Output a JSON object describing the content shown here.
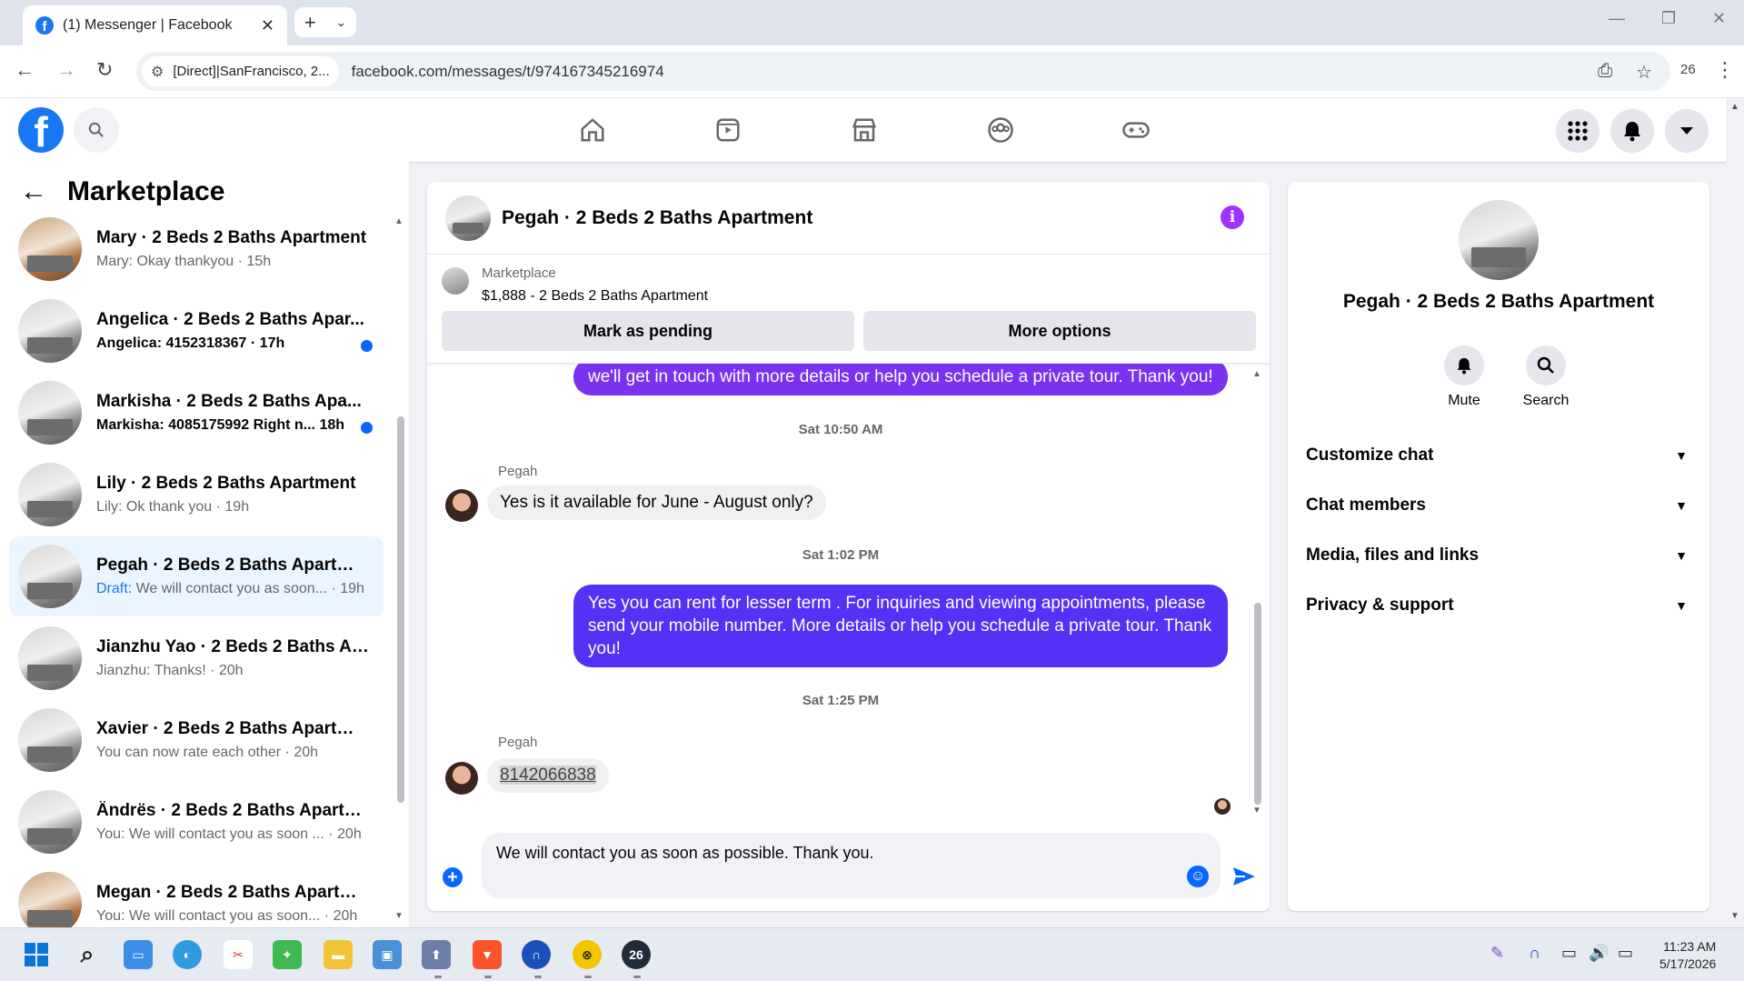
{
  "browser": {
    "tab_title": "(1) Messenger | Facebook",
    "site_chip": "[Direct]|SanFrancisco, 2...",
    "url": "facebook.com/messages/t/974167345216974",
    "extension_badge": "26"
  },
  "left": {
    "title": "Marketplace",
    "conversations": [
      {
        "name": "Mary · 2 Beds 2 Baths Apartment",
        "preview": "Mary: Okay thankyou · 15h",
        "unread": false
      },
      {
        "name": "Angelica · 2 Beds 2 Baths Apar...",
        "preview": "Angelica: 4152318367 · 17h",
        "unread": true
      },
      {
        "name": "Markisha · 2 Beds 2 Baths Apa...",
        "preview": "Markisha: 4085175992 Right n...   18h",
        "unread": true
      },
      {
        "name": "Lily · 2 Beds 2 Baths Apartment",
        "preview": "Lily: Ok thank you · 19h",
        "unread": false
      },
      {
        "name": "Pegah · 2 Beds 2 Baths Apartment",
        "draft_label": "Draft:",
        "preview": " We will contact you as soon... · 19h",
        "unread": false
      },
      {
        "name": "Jianzhu Yao · 2 Beds 2 Baths Ap...",
        "preview": "Jianzhu: Thanks! · 20h",
        "unread": false
      },
      {
        "name": "Xavier · 2 Beds 2 Baths Apartment",
        "preview": "You can now rate each other · 20h",
        "unread": false
      },
      {
        "name": "Ändrës · 2 Beds 2 Baths Apartm...",
        "preview": "You: We will contact you as soon ...  · 20h",
        "unread": false
      },
      {
        "name": "Megan · 2 Beds 2 Baths Apartm...",
        "preview": "You: We will contact you as soon... · 20h",
        "unread": false
      }
    ]
  },
  "chat": {
    "title": "Pegah · 2 Beds 2 Baths Apartment",
    "marketplace_label": "Marketplace",
    "listing": "$1,888 - 2 Beds 2 Baths Apartment",
    "mark_pending": "Mark as pending",
    "more_options": "More options",
    "messages": {
      "out1": "we'll get in touch with more details or help you schedule a private tour. Thank you!",
      "ts1": "Sat 10:50 AM",
      "sender1": "Pegah",
      "in1": "Yes is it available for June - August only?",
      "ts2": "Sat 1:02 PM",
      "out2": "Yes you can rent for lesser term .  For inquiries and viewing appointments, please send your mobile number. More details or help you schedule a private tour. Thank you!",
      "ts3": "Sat 1:25 PM",
      "sender2": "Pegah",
      "in2": "8142066838"
    },
    "composer_text": "We will contact you as soon as possible. Thank you."
  },
  "right": {
    "name": "Pegah · 2 Beds 2 Baths Apartment",
    "mute": "Mute",
    "search": "Search",
    "sections": [
      "Customize chat",
      "Chat members",
      "Media, files and links",
      "Privacy & support"
    ]
  },
  "taskbar": {
    "time": "11:23 AM",
    "date": "5/17/2026",
    "badge": "26"
  },
  "colors": {
    "fb_blue": "#1877f2",
    "outgoing_purple": "#7a31f0",
    "outgoing_blue": "#5530f5",
    "active_conversation": "#ebf5ff"
  }
}
